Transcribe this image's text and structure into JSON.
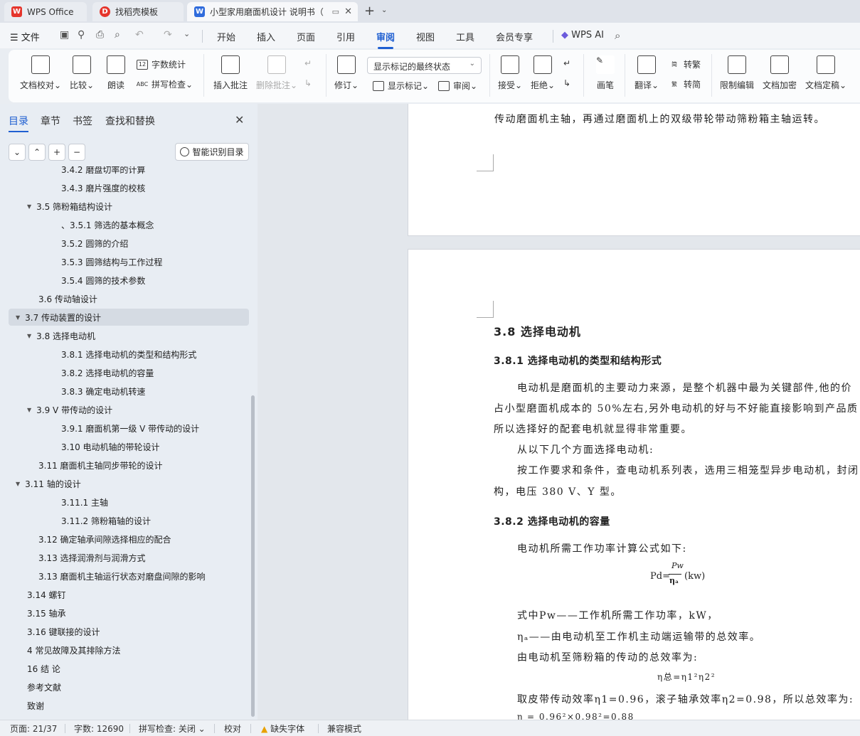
{
  "tabs": [
    {
      "label": "WPS Office",
      "icon": "wps-logo-icon"
    },
    {
      "label": "找稻壳模板",
      "icon": "docer-template-icon"
    },
    {
      "label": "小型家用磨面机设计 说明书（",
      "icon": "wps-writer-doc-icon"
    }
  ],
  "menu": {
    "file_label": "文件",
    "tabs": [
      "开始",
      "插入",
      "页面",
      "引用",
      "审阅",
      "视图",
      "工具",
      "会员专享"
    ],
    "active_tab": "审阅",
    "ai_label": "WPS AI"
  },
  "ribbon": {
    "doc_check": "文档校对",
    "compare": "比较",
    "read_aloud": "朗读",
    "word_count": "字数统计",
    "spell_check": "拼写检查",
    "insert_comment": "插入批注",
    "delete_comment": "删除批注",
    "revise": "修订",
    "markup_state": "显示标记的最终状态",
    "show_markup": "显示标记",
    "review": "审阅",
    "accept": "接受",
    "reject": "拒绝",
    "ink": "画笔",
    "translate": "翻译",
    "to_traditional": "转繁",
    "to_simplified": "转简",
    "restrict_edit": "限制编辑",
    "encrypt": "文档加密",
    "finalize": "文档定稿"
  },
  "nav": {
    "tabs": [
      "目录",
      "章节",
      "书签",
      "查找和替换"
    ],
    "smart_toc": "智能识别目录",
    "items": [
      {
        "text": "3.4.2  磨盘切率的计算",
        "level": 3,
        "arrow": ""
      },
      {
        "text": "3.4.3 磨片强度的校核",
        "level": 3,
        "arrow": ""
      },
      {
        "text": "3.5  筛粉箱结构设计",
        "level": 2,
        "arrow": "▼"
      },
      {
        "text": "、3.5.1  筛选的基本概念",
        "level": 3,
        "arrow": ""
      },
      {
        "text": "3.5.2 圆筛的介绍",
        "level": 3,
        "arrow": ""
      },
      {
        "text": "3.5.3  圆筛结构与工作过程",
        "level": 3,
        "arrow": ""
      },
      {
        "text": "3.5.4  圆筛的技术参数",
        "level": 3,
        "arrow": ""
      },
      {
        "text": "3.6  传动轴设计",
        "level": 2,
        "arrow": ""
      },
      {
        "text": "3.7  传动装置的设计",
        "level": 1,
        "arrow": "▼"
      },
      {
        "text": "3.8  选择电动机",
        "level": 2,
        "arrow": "▼"
      },
      {
        "text": "3.8.1  选择电动机的类型和结构形式",
        "level": 3,
        "arrow": ""
      },
      {
        "text": "3.8.2  选择电动机的容量",
        "level": 3,
        "arrow": ""
      },
      {
        "text": "3.8.3  确定电动机转速",
        "level": 3,
        "arrow": ""
      },
      {
        "text": "3.9 V 带传动的设计",
        "level": 2,
        "arrow": "▼"
      },
      {
        "text": "3.9.1  磨面机第一级 V 带传动的设计",
        "level": 3,
        "arrow": ""
      },
      {
        "text": "3.10 电动机轴的带轮设计",
        "level": 3,
        "arrow": ""
      },
      {
        "text": "3.11  磨面机主轴同步带轮的设计",
        "level": 2,
        "arrow": ""
      },
      {
        "text": "3.11  轴的设计",
        "level": 1,
        "arrow": "▼"
      },
      {
        "text": "3.11.1  主轴",
        "level": 3,
        "arrow": ""
      },
      {
        "text": "3.11.2  筛粉箱轴的设计",
        "level": 3,
        "arrow": ""
      },
      {
        "text": "3.12  确定轴承间隙选择相应的配合",
        "level": 2,
        "arrow": ""
      },
      {
        "text": "3.13 选择润滑剂与润滑方式",
        "level": 2,
        "arrow": ""
      },
      {
        "text": "3.13  磨面机主轴运行状态对磨盘间隙的影响",
        "level": 2,
        "arrow": ""
      },
      {
        "text": "3.14  螺钉",
        "level": 1,
        "arrow": ""
      },
      {
        "text": "3.15 轴承",
        "level": 1,
        "arrow": ""
      },
      {
        "text": "3.16    键联接的设计",
        "level": 1,
        "arrow": ""
      },
      {
        "text": "4  常见故障及其排除方法",
        "level": 1,
        "arrow": ""
      },
      {
        "text": "16  结  论",
        "level": 1,
        "arrow": ""
      },
      {
        "text": "参考文献",
        "level": 1,
        "arrow": ""
      },
      {
        "text": "致谢",
        "level": 1,
        "arrow": ""
      }
    ]
  },
  "document": {
    "page1_line": "传动磨面机主轴，再通过磨面机上的双级带轮带动筛粉箱主轴运转。",
    "h1": "3.8  选择电动机",
    "h2_1": "3.8.1  选择电动机的类型和结构形式",
    "para1": "电动机是磨面机的主要动力来源，是整个机器中最为关键部件,他的价",
    "para2": "占小型磨面机成本的 50%左右,另外电动机的好与不好能直接影响到产品质",
    "para3": "所以选择好的配套电机就显得非常重要。",
    "para4": "从以下几个方面选择电动机:",
    "para5": "按工作要求和条件，查电动机系列表，选用三相笼型异步电动机，封闭",
    "para6": "构，电压 380   V、Y 型。",
    "h2_2": "3.8.2  选择电动机的容量",
    "para7": "电动机所需工作功率计算公式如下:",
    "formula_lhs": "Pd=",
    "formula_num": "Pw",
    "formula_den": "ηₐ",
    "formula_unit": "(kw)",
    "para8": "式中Pw——工作机所需工作功率，kW，",
    "para9": "ηₐ——由电动机至工作机主动端运输带的总效率。",
    "para10": "由电动机至筛粉箱的传动的总效率为:",
    "formula2": "η总=η1²η2²",
    "para11": "取皮带传动效率η1=0.96，滚子轴承效率η2=0.98，所以总效率为:",
    "para12": "η = 0.96²×0.98²=0.88"
  },
  "status": {
    "page": "页面: 21/37",
    "words": "字数: 12690",
    "spell": "拼写检查: 关闭",
    "proof": "校对",
    "missing_font": "缺失字体",
    "compat": "兼容模式"
  }
}
